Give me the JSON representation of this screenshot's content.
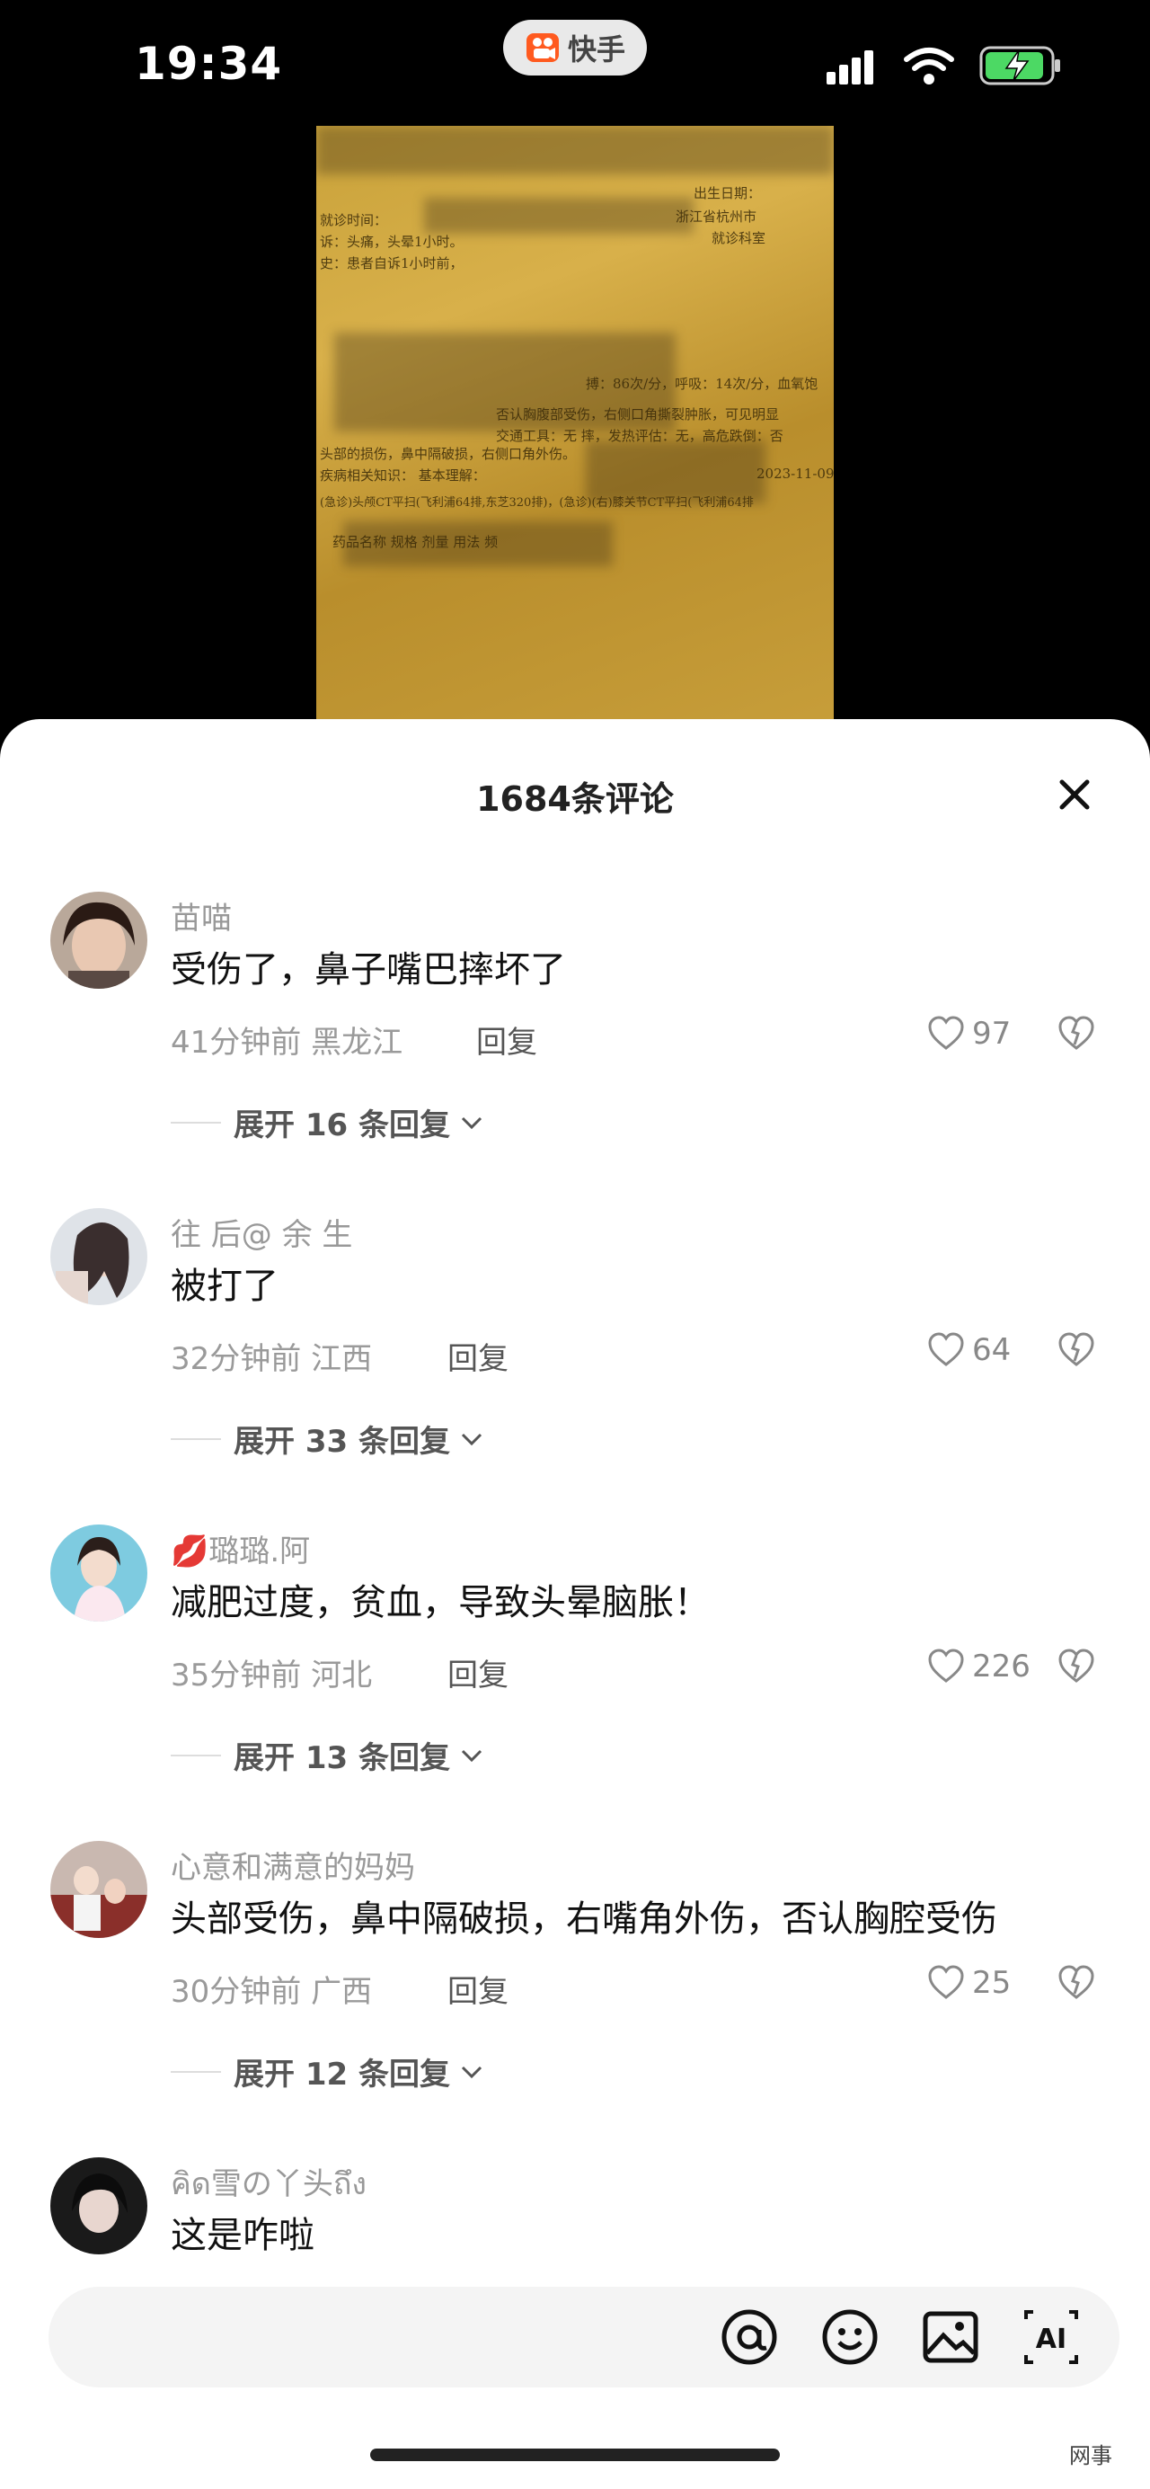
{
  "status_bar": {
    "time": "19:34",
    "app_name": "快手"
  },
  "sheet": {
    "title": "1684条评论"
  },
  "comments": [
    {
      "username": "苗喵",
      "text": "受伤了，鼻子嘴巴摔坏了",
      "meta": "41分钟前 黑龙江",
      "reply_label": "回复",
      "likes": "97",
      "expand": "展开 16 条回复"
    },
    {
      "username": "往 后@ 余 生",
      "text": "被打了",
      "meta": "32分钟前 江西",
      "reply_label": "回复",
      "likes": "64",
      "expand": "展开 33 条回复"
    },
    {
      "username": "💋璐璐.阿",
      "text": "减肥过度，贫血，导致头晕脑胀！",
      "meta": "35分钟前 河北",
      "reply_label": "回复",
      "likes": "226",
      "expand": "展开 13 条回复"
    },
    {
      "username": "心意和满意的妈妈",
      "text": "头部受伤，鼻中隔破损，右嘴角外伤，否认胸腔受伤",
      "meta": "30分钟前 广西",
      "reply_label": "回复",
      "likes": "25",
      "expand": "展开 12 条回复"
    },
    {
      "username": "คิด雪の丫头ถึง",
      "text": "这是咋啦",
      "meta": "",
      "reply_label": "",
      "likes": "",
      "expand": ""
    }
  ],
  "document_visible_text": {
    "line1": "就诊时间：",
    "line2": "诉：头痛，头晕1小时。",
    "line3": "史：患者自诉1小时前，",
    "line4": "搏：86次/分，呼吸：14次/分，血氧饱",
    "line5": "否认胸腹部受伤，右侧口角撕裂肿胀，可见明显",
    "line6": "头部的损伤，鼻中隔破损，右侧口角外伤。",
    "line7": "疾病相关知识： 基本理解：",
    "line8": "2023-11-09",
    "line9": "(急诊)头颅CT平扫(飞利浦64排,东芝320排)，(急诊)(右)膝关节CT平扫(飞利浦64排",
    "line10": "药品名称  规格  剂量  用法  频",
    "line11": "交通工具：无 摔，发热评估：无，高危跌倒：否",
    "line12": "浙江省杭州市",
    "line13": "出生日期：",
    "line14": "就诊科室"
  },
  "watermark": "网事",
  "colors": {
    "accent_orange": "#ff5a1f",
    "battery_green": "#4cd964"
  }
}
